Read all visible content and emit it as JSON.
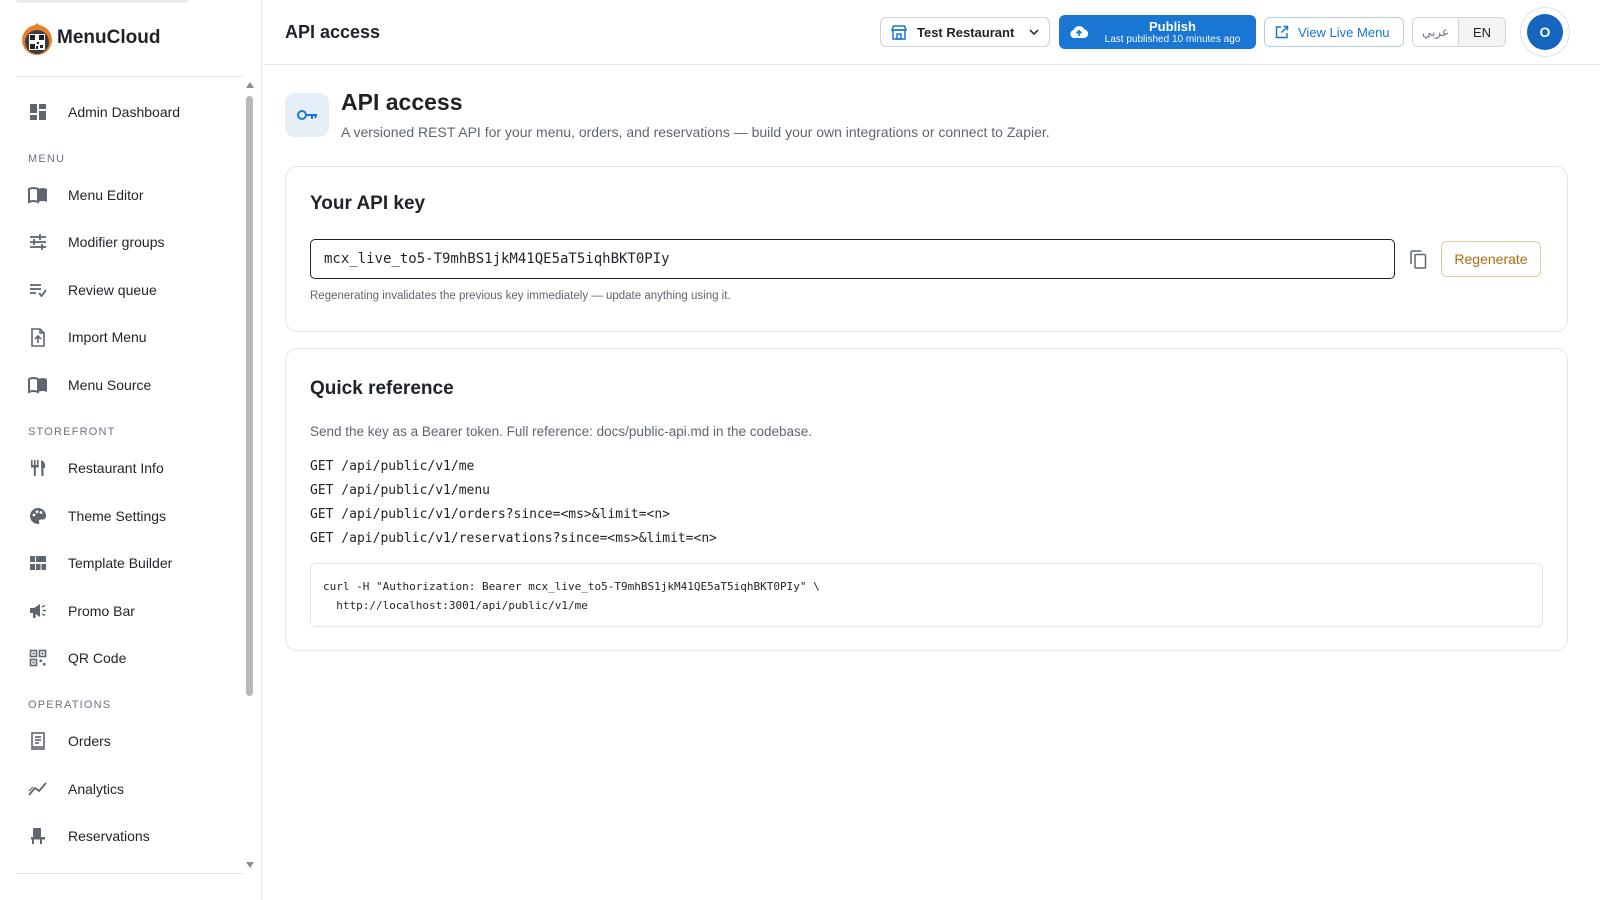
{
  "brand": {
    "name": "MenuCloud"
  },
  "sidebar": {
    "items": [
      {
        "label": "Admin Dashboard",
        "icon": "dashboard-icon"
      },
      {
        "section": "MENU"
      },
      {
        "label": "Menu Editor",
        "icon": "menu-book-icon"
      },
      {
        "label": "Modifier groups",
        "icon": "tune-icon"
      },
      {
        "label": "Review queue",
        "icon": "playlist-check-icon"
      },
      {
        "label": "Import Menu",
        "icon": "file-upload-icon"
      },
      {
        "label": "Menu Source",
        "icon": "menu-book-icon"
      },
      {
        "section": "STOREFRONT"
      },
      {
        "label": "Restaurant Info",
        "icon": "restaurant-icon"
      },
      {
        "label": "Theme Settings",
        "icon": "palette-icon"
      },
      {
        "label": "Template Builder",
        "icon": "grid-layout-icon"
      },
      {
        "label": "Promo Bar",
        "icon": "megaphone-icon"
      },
      {
        "label": "QR Code",
        "icon": "qr-code-icon"
      },
      {
        "section": "OPERATIONS"
      },
      {
        "label": "Orders",
        "icon": "receipt-icon"
      },
      {
        "label": "Analytics",
        "icon": "analytics-icon"
      },
      {
        "label": "Reservations",
        "icon": "table-chair-icon"
      }
    ]
  },
  "header": {
    "title": "API access",
    "restaurant": "Test Restaurant",
    "publish_label": "Publish",
    "publish_sub": "Last published 10 minutes ago",
    "view_live_label": "View Live Menu",
    "lang_ar": "عربي",
    "lang_en": "EN",
    "avatar_initial": "O"
  },
  "page": {
    "title": "API access",
    "subtitle": "A versioned REST API for your menu, orders, and reservations — build your own integrations or connect to Zapier."
  },
  "api_key_card": {
    "title": "Your API key",
    "key": "mcx_live_to5-T9mhBS1jkM41QE5aT5iqhBKT0PIy",
    "regenerate_label": "Regenerate",
    "hint": "Regenerating invalidates the previous key immediately — update anything using it."
  },
  "quick_ref": {
    "title": "Quick reference",
    "description": "Send the key as a Bearer token. Full reference: docs/public-api.md in the codebase.",
    "endpoints": [
      "GET /api/public/v1/me",
      "GET /api/public/v1/menu",
      "GET /api/public/v1/orders?since=<ms>&limit=<n>",
      "GET /api/public/v1/reservations?since=<ms>&limit=<n>"
    ],
    "curl_line1": "curl -H \"Authorization: Bearer mcx_live_to5-T9mhBS1jkM41QE5aT5iqhBKT0PIy\" \\",
    "curl_line2": "  http://localhost:3001/api/public/v1/me"
  },
  "colors": {
    "accent": "#1976d2",
    "avatar": "#1565c0",
    "warning": "#b06b12"
  }
}
